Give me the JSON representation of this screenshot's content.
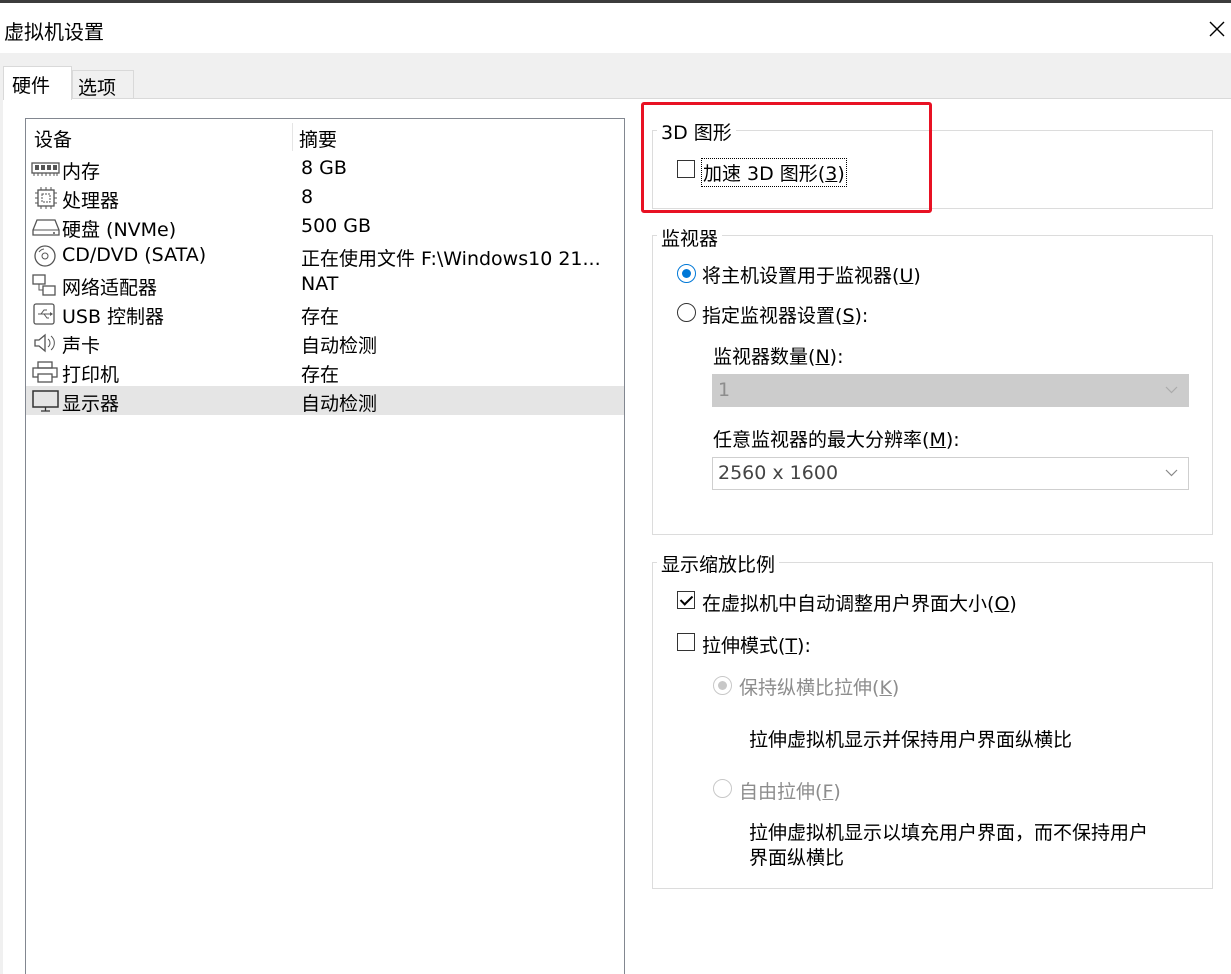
{
  "window": {
    "title": "虚拟机设置"
  },
  "tabs": [
    {
      "label": "硬件",
      "active": true
    },
    {
      "label": "选项",
      "active": false
    }
  ],
  "device_list": {
    "headers": {
      "device": "设备",
      "summary": "摘要"
    },
    "rows": [
      {
        "icon": "memory-icon",
        "name": "内存",
        "summary": "8 GB"
      },
      {
        "icon": "processor-icon",
        "name": "处理器",
        "summary": "8"
      },
      {
        "icon": "hard-disk-icon",
        "name": "硬盘 (NVMe)",
        "summary": "500 GB"
      },
      {
        "icon": "cd-dvd-icon",
        "name": "CD/DVD (SATA)",
        "summary": "正在使用文件 F:\\Windows10 21..."
      },
      {
        "icon": "network-adapter-icon",
        "name": "网络适配器",
        "summary": "NAT"
      },
      {
        "icon": "usb-icon",
        "name": "USB 控制器",
        "summary": "存在"
      },
      {
        "icon": "speaker-icon",
        "name": "声卡",
        "summary": "自动检测"
      },
      {
        "icon": "printer-icon",
        "name": "打印机",
        "summary": "存在"
      },
      {
        "icon": "monitor-icon",
        "name": "显示器",
        "summary": "自动检测",
        "selected": true
      }
    ]
  },
  "graphics_3d": {
    "title": "3D 图形",
    "accelerate": {
      "label": "加速 3D 图形",
      "key": "3",
      "checked": false
    }
  },
  "monitors": {
    "title": "监视器",
    "use_host": {
      "label": "将主机设置用于监视器",
      "key": "U",
      "selected": true
    },
    "specify": {
      "label": "指定监视器设置",
      "key": "S",
      "suffix": ":",
      "selected": false
    },
    "count": {
      "label": "监视器数量",
      "key": "N",
      "suffix": ":",
      "value": "1",
      "enabled": false
    },
    "max_resolution": {
      "label": "任意监视器的最大分辨率",
      "key": "M",
      "suffix": ":",
      "value": "2560 x 1600"
    }
  },
  "display_scaling": {
    "title": "显示缩放比例",
    "autofit": {
      "label": "在虚拟机中自动调整用户界面大小",
      "key": "O",
      "checked": true
    },
    "stretch": {
      "label": "拉伸模式",
      "key": "T",
      "suffix": ":",
      "checked": false
    },
    "keep_aspect": {
      "label": "保持纵横比拉伸",
      "key": "K",
      "selected": true,
      "enabled": false,
      "description": "拉伸虚拟机显示并保持用户界面纵横比"
    },
    "free_stretch": {
      "label": "自由拉伸",
      "key": "F",
      "selected": false,
      "enabled": false,
      "description_line1": "拉伸虚拟机显示以填充用户界面，而不保持用户",
      "description_line2": "界面纵横比"
    }
  },
  "colors": {
    "accent": "#0078d7",
    "highlight": "#e81123",
    "selected_row": "#e5e5e5",
    "disabled_select": "#cccccc"
  }
}
